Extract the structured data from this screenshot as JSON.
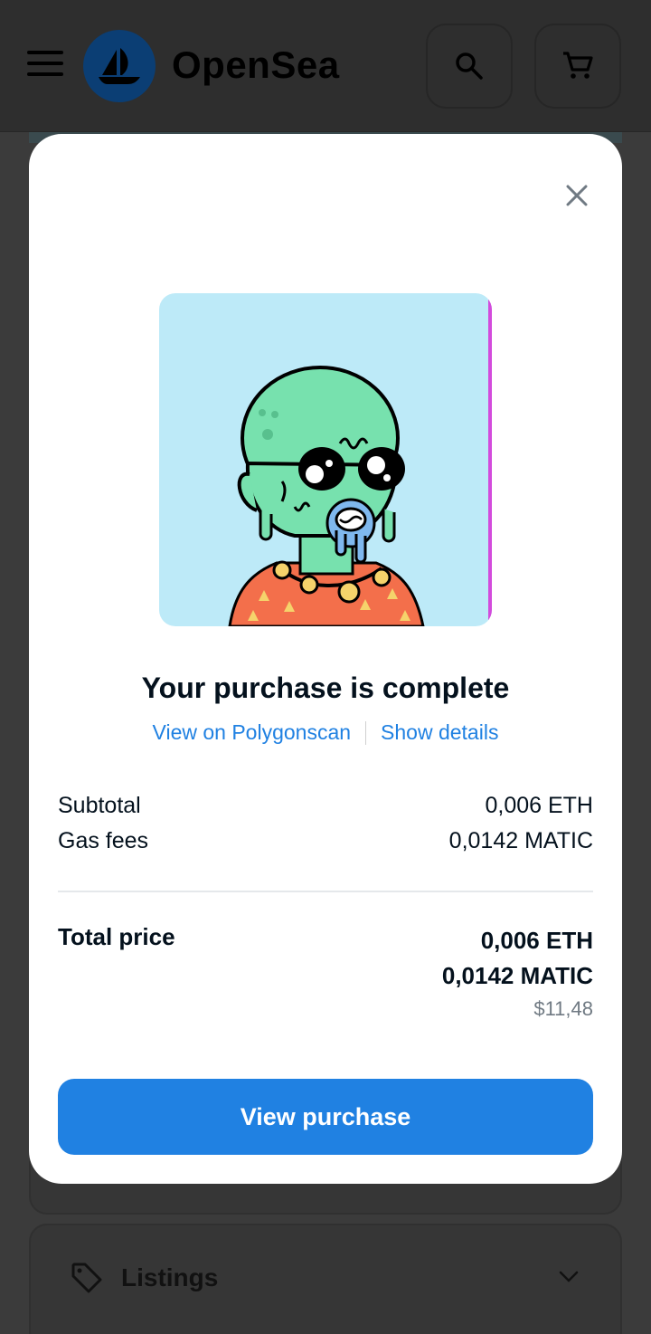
{
  "header": {
    "brand": "OpenSea",
    "icons": [
      "menu-icon",
      "opensea-logo",
      "search-icon",
      "cart-icon"
    ]
  },
  "modal": {
    "title": "Your purchase is complete",
    "links": {
      "polygonscan": "View on Polygonscan",
      "details": "Show details"
    },
    "subtotal": {
      "label": "Subtotal",
      "value": "0,006 ETH"
    },
    "gas_fees": {
      "label": "Gas fees",
      "value": "0,0142 MATIC"
    },
    "total": {
      "label": "Total price",
      "eth": "0,006 ETH",
      "matic": "0,0142 MATIC",
      "usd": "$11,48"
    },
    "button": "View purchase"
  },
  "background": {
    "listings_label": "Listings"
  },
  "colors": {
    "accent": "#2081e2",
    "overlay": "#3b3b3b",
    "nft_bg": "#bdeaf8"
  }
}
